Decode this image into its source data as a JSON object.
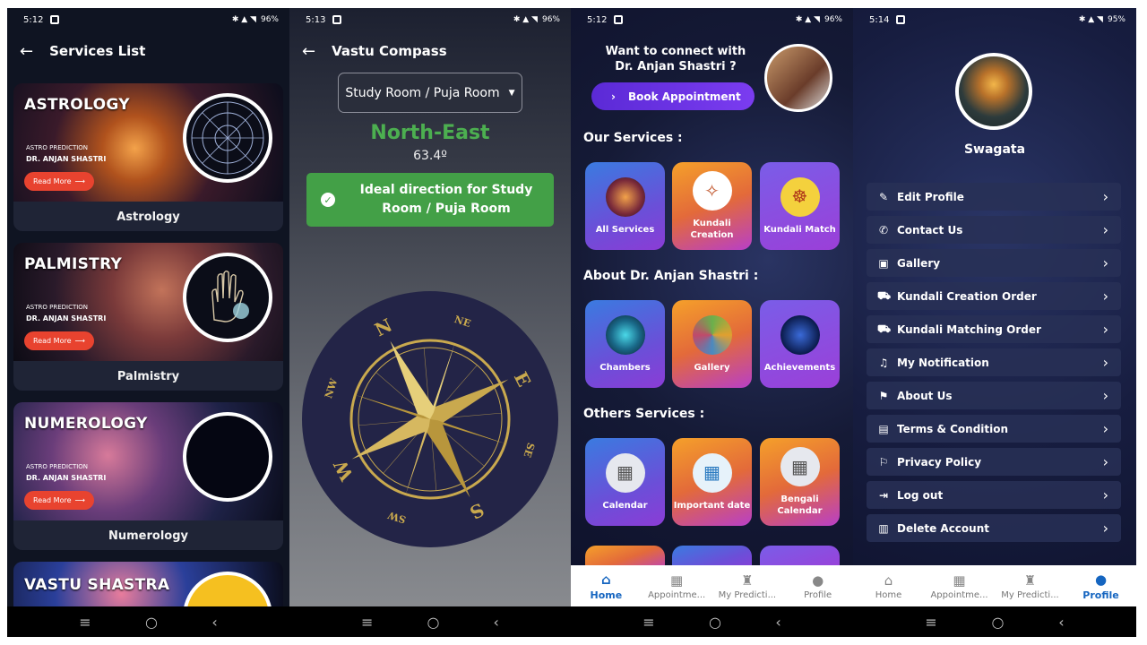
{
  "panels": {
    "services": {
      "status": {
        "time": "5:12",
        "battery": "96%"
      },
      "title": "Services List",
      "cards": [
        {
          "title": "ASTROLOGY",
          "sub1": "ASTRO PREDICTION",
          "sub2": "DR. ANJAN SHASTRI",
          "button": "Read More",
          "label": "Astrology",
          "color": "#b0521d"
        },
        {
          "title": "PALMISTRY",
          "sub1": "ASTRO PREDICTION",
          "sub2": "DR. ANJAN SHASTRI",
          "button": "Read More",
          "label": "Palmistry",
          "color": "#7a3a3a"
        },
        {
          "title": "NUMEROLOGY",
          "sub1": "ASTRO PREDICTION",
          "sub2": "DR. ANJAN SHASTRI",
          "button": "Read More",
          "label": "Numerology",
          "color": "#6a3d7a"
        },
        {
          "title": "VASTU SHASTRA",
          "label": "",
          "color": "#2a3f9a"
        }
      ]
    },
    "vastu": {
      "status": {
        "time": "5:13",
        "battery": "96%"
      },
      "title": "Vastu Compass",
      "room_select": "Study Room / Puja Room",
      "direction": "North-East",
      "degree": "63.4º",
      "ideal_message": "Ideal direction for Study Room / Puja Room",
      "compass_labels": {
        "n": "N",
        "ne": "NE",
        "e": "E",
        "se": "SE",
        "s": "S",
        "sw": "SW",
        "w": "W",
        "nw": "NW"
      }
    },
    "home": {
      "status": {
        "time": "5:12",
        "battery": "96%"
      },
      "connect_text": "Want to connect with Dr. Anjan Shastri ?",
      "book_button": "Book Appointment",
      "sections": {
        "our_services": "Our Services :",
        "about": "About Dr. Anjan Shastri :",
        "others": "Others Services :"
      },
      "our_services": [
        "All Services",
        "Kundali Creation",
        "Kundali Match"
      ],
      "about_items": [
        "Chambers",
        "Gallery",
        "Achievements"
      ],
      "other_items": [
        "Calendar",
        "Important date",
        "Bengali Calendar"
      ],
      "nav": [
        "Home",
        "Appointme...",
        "My Predicti...",
        "Profile"
      ]
    },
    "profile": {
      "status": {
        "time": "5:14",
        "battery": "95%"
      },
      "username": "Swagata",
      "menu": [
        "Edit Profile",
        "Contact Us",
        "Gallery",
        "Kundali Creation Order",
        "Kundali Matching Order",
        "My Notification",
        "About Us",
        "Terms & Condition",
        "Privacy Policy",
        "Log out",
        "Delete Account"
      ],
      "nav": [
        "Home",
        "Appointme...",
        "My Predicti...",
        "Profile"
      ]
    }
  },
  "colors": {
    "accent_green": "#43a047",
    "nav_active": "#1565c0",
    "read_more": "#e8432f"
  }
}
